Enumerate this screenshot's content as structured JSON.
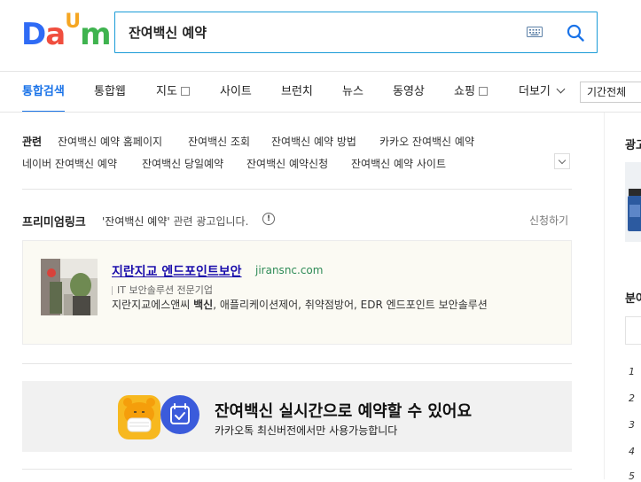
{
  "logo": {
    "text_1": "D",
    "text_2": "a",
    "text_3": "U",
    "text_4": "m"
  },
  "search": {
    "query": "잔여백신 예약",
    "keyboard_icon": "keyboard-icon",
    "search_icon": "search-icon",
    "accent": "#1a9bd7"
  },
  "tabs": [
    {
      "label": "통합검색",
      "active": true
    },
    {
      "label": "통합웹"
    },
    {
      "label": "지도",
      "has_checkbox": true
    },
    {
      "label": "사이트"
    },
    {
      "label": "브런치"
    },
    {
      "label": "뉴스"
    },
    {
      "label": "동영상"
    },
    {
      "label": "쇼핑",
      "has_checkbox": true
    },
    {
      "label": "더보기",
      "has_chevron": true
    }
  ],
  "period_select": {
    "value": "기간전체"
  },
  "related": {
    "label": "관련",
    "items": [
      "잔여백신 예약 홈페이지",
      "잔여백신 조회",
      "잔여백신 예약 방법",
      "카카오 잔여백신 예약",
      "네이버 잔여백신 예약",
      "잔여백신 당일예약",
      "잔여백신 예약신청",
      "잔여백신 예약 사이트"
    ]
  },
  "premium": {
    "title": "프리미엄링크",
    "quoted_query": "'잔여백신 예약'",
    "desc_suffix": "관련 광고입니다.",
    "info_glyph": "!",
    "apply": "신청하기"
  },
  "ad": {
    "title": "지란지교 엔드포인트보안",
    "domain": "jiransnc.com",
    "subtitle": "IT 보안솔루션 전문기업",
    "body_before": "지란지교에스앤씨 ",
    "body_bold": "백신",
    "body_after": ", 애플리케이션제어, 취약점방어, EDR 엔드포인트 보안솔루션"
  },
  "banner": {
    "title": "잔여백신 실시간으로 예약할 수 있어요",
    "subtitle": "카카오톡 최신버전에서만 사용가능합니다"
  },
  "right_panel": {
    "ad_label": "광고",
    "section_label": "분야",
    "numbers": [
      "1",
      "2",
      "3",
      "4",
      "5"
    ]
  },
  "colors": {
    "active_tab": "#1a73e8",
    "link": "#1a0dab",
    "domain": "#2e8b57",
    "banner_bg": "#f1f1f1",
    "ad_bg": "#fbfaf3"
  }
}
